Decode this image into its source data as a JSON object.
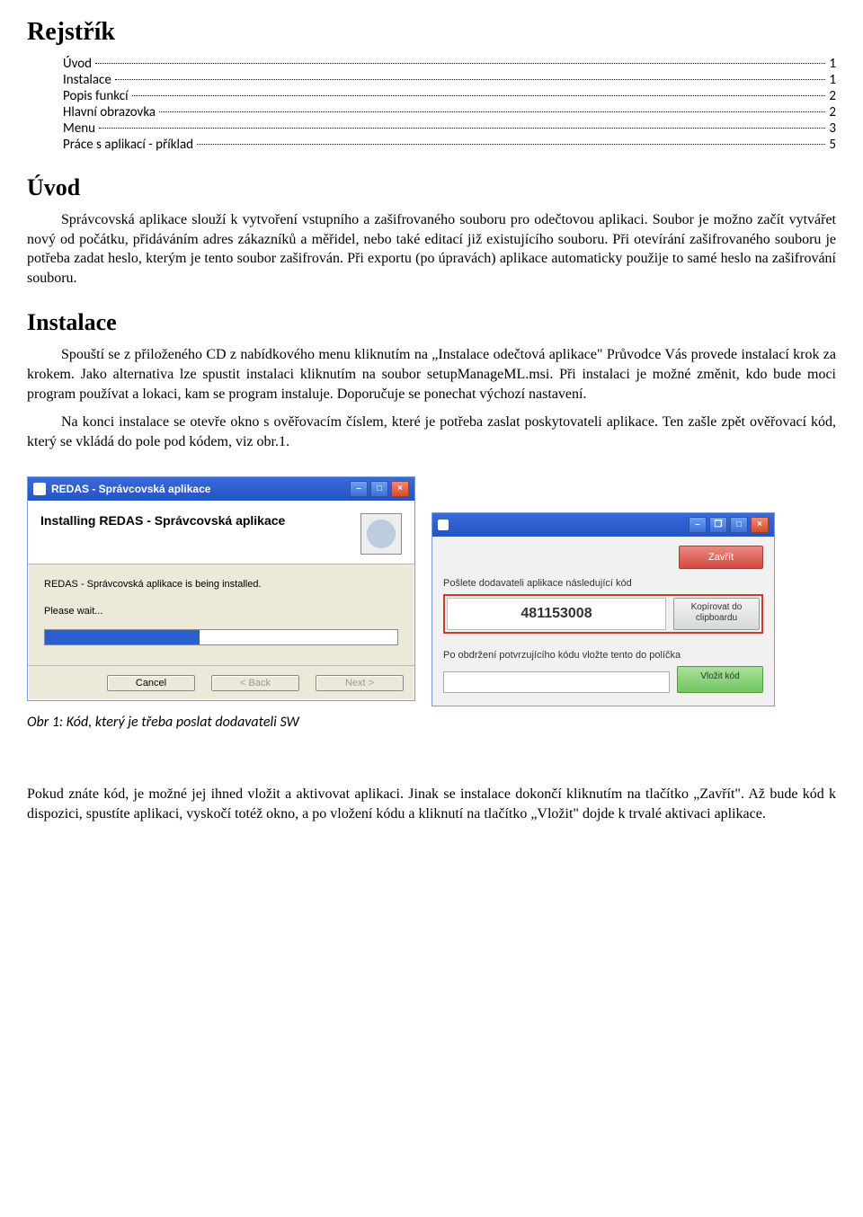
{
  "headings": {
    "rejstrik": "Rejstřík",
    "uvod": "Úvod",
    "instalace": "Instalace"
  },
  "toc": [
    {
      "label": "Úvod",
      "page": "1"
    },
    {
      "label": "Instalace",
      "page": "1"
    },
    {
      "label": "Popis funkcí",
      "page": "2"
    },
    {
      "label": "Hlavní obrazovka",
      "page": "2"
    },
    {
      "label": "Menu",
      "page": "3"
    },
    {
      "label": "Práce s aplikací - příklad",
      "page": "5"
    }
  ],
  "paragraphs": {
    "uvod": "Správcovská aplikace slouží k vytvoření vstupního a zašifrovaného souboru pro odečtovou aplikaci. Soubor je možno začít vytvářet nový od počátku, přidáváním adres zákazníků a měřidel, nebo také editací již existujícího souboru. Při otevírání zašifrovaného souboru je potřeba zadat heslo, kterým je tento soubor zašifrován. Při exportu (po úpravách) aplikace automaticky použije to samé heslo na zašifrování souboru.",
    "instalace_1": "Spouští se z přiloženého CD  z nabídkového menu kliknutím na „Instalace odečtová aplikace\" Průvodce Vás provede instalací krok za krokem. Jako alternativa lze spustit instalaci kliknutím na soubor setupManageML.msi. Při instalaci je možné změnit, kdo bude moci program používat a lokaci, kam se program instaluje. Doporučuje se ponechat výchozí nastavení.",
    "instalace_2": "Na konci instalace se otevře okno s ověřovacím číslem, které je potřeba zaslat poskytovateli aplikace. Ten zašle zpět ověřovací kód, který se vkládá do pole pod kódem, viz obr.1.",
    "final": "Pokud znáte kód, je možné jej ihned vložit a aktivovat aplikaci. Jinak se instalace dokončí kliknutím na tlačítko „Zavřít\". Až bude kód k dispozici, spustíte aplikaci, vyskočí totéž okno, a po vložení kódu a kliknutí na tlačítko „Vložit\" dojde  k trvalé aktivaci aplikace."
  },
  "caption": "Obr 1: Kód, který je třeba poslat dodavateli SW",
  "installer": {
    "title": "REDAS - Správcovská aplikace",
    "banner_title": "Installing REDAS - Správcovská aplikace",
    "status": "REDAS - Správcovská aplikace is being installed.",
    "wait": "Please wait...",
    "buttons": {
      "cancel": "Cancel",
      "back": "< Back",
      "next": "Next >"
    }
  },
  "verify": {
    "close": "Zavřít",
    "send_label": "Pošlete dodavateli aplikace následující kód",
    "code": "481153008",
    "copy": "Kopírovat do clipboardu",
    "after_label": "Po obdržení potvrzujícího kódu vložte tento do políčka",
    "insert": "Vložit kód"
  }
}
